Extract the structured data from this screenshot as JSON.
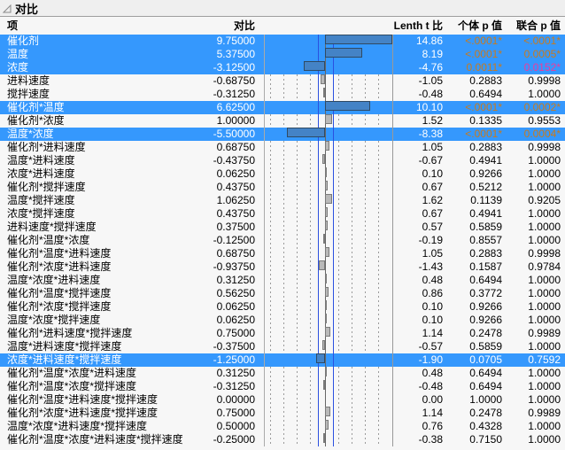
{
  "title": "对比",
  "disclosure_icon": "triangle-expanded-icon",
  "columns": {
    "term": "项",
    "contrast": "对比",
    "lenth_t": "Lenth t 比",
    "p_individual": "个体 p 值",
    "p_simultaneous": "联合 p 值"
  },
  "colors": {
    "row_highlight": "#3598fd",
    "significant_orange": "#c87a1e",
    "significant_pink": "#ef3a9b",
    "bar_highlight_fill": "#4483c6",
    "bar_normal_fill": "#b9b9b9",
    "reference_line_blue": "#2b50e0"
  },
  "rows": [
    {
      "term": "催化剂",
      "contrast": "9.75000",
      "t": "14.86",
      "p1": "<.0001*",
      "p2": "<.0001*",
      "hl": true,
      "p1c": "orange",
      "p2c": "orange",
      "v": 9.75
    },
    {
      "term": "温度",
      "contrast": "5.37500",
      "t": "8.19",
      "p1": "<.0001*",
      "p2": "0.0005*",
      "hl": true,
      "p1c": "orange",
      "p2c": "orange",
      "v": 5.375
    },
    {
      "term": "浓度",
      "contrast": "-3.12500",
      "t": "-4.76",
      "p1": "0.0011*",
      "p2": "0.0152*",
      "hl": true,
      "p1c": "orange",
      "p2c": "pink",
      "v": -3.125
    },
    {
      "term": "进料速度",
      "contrast": "-0.68750",
      "t": "-1.05",
      "p1": "0.2883",
      "p2": "0.9998",
      "hl": false,
      "p1c": null,
      "p2c": null,
      "v": -0.6875
    },
    {
      "term": "搅拌速度",
      "contrast": "-0.31250",
      "t": "-0.48",
      "p1": "0.6494",
      "p2": "1.0000",
      "hl": false,
      "p1c": null,
      "p2c": null,
      "v": -0.3125
    },
    {
      "term": "催化剂*温度",
      "contrast": "6.62500",
      "t": "10.10",
      "p1": "<.0001*",
      "p2": "0.0002*",
      "hl": true,
      "p1c": "orange",
      "p2c": "orange",
      "v": 6.625
    },
    {
      "term": "催化剂*浓度",
      "contrast": "1.00000",
      "t": "1.52",
      "p1": "0.1335",
      "p2": "0.9553",
      "hl": false,
      "p1c": null,
      "p2c": null,
      "v": 1.0
    },
    {
      "term": "温度*浓度",
      "contrast": "-5.50000",
      "t": "-8.38",
      "p1": "<.0001*",
      "p2": "0.0004*",
      "hl": true,
      "p1c": "orange",
      "p2c": "orange",
      "v": -5.5
    },
    {
      "term": "催化剂*进料速度",
      "contrast": "0.68750",
      "t": "1.05",
      "p1": "0.2883",
      "p2": "0.9998",
      "hl": false,
      "p1c": null,
      "p2c": null,
      "v": 0.6875
    },
    {
      "term": "温度*进料速度",
      "contrast": "-0.43750",
      "t": "-0.67",
      "p1": "0.4941",
      "p2": "1.0000",
      "hl": false,
      "p1c": null,
      "p2c": null,
      "v": -0.4375
    },
    {
      "term": "浓度*进料速度",
      "contrast": "0.06250",
      "t": "0.10",
      "p1": "0.9266",
      "p2": "1.0000",
      "hl": false,
      "p1c": null,
      "p2c": null,
      "v": 0.0625
    },
    {
      "term": "催化剂*搅拌速度",
      "contrast": "0.43750",
      "t": "0.67",
      "p1": "0.5212",
      "p2": "1.0000",
      "hl": false,
      "p1c": null,
      "p2c": null,
      "v": 0.4375
    },
    {
      "term": "温度*搅拌速度",
      "contrast": "1.06250",
      "t": "1.62",
      "p1": "0.1139",
      "p2": "0.9205",
      "hl": false,
      "p1c": null,
      "p2c": null,
      "v": 1.0625
    },
    {
      "term": "浓度*搅拌速度",
      "contrast": "0.43750",
      "t": "0.67",
      "p1": "0.4941",
      "p2": "1.0000",
      "hl": false,
      "p1c": null,
      "p2c": null,
      "v": 0.4375
    },
    {
      "term": "进料速度*搅拌速度",
      "contrast": "0.37500",
      "t": "0.57",
      "p1": "0.5859",
      "p2": "1.0000",
      "hl": false,
      "p1c": null,
      "p2c": null,
      "v": 0.375
    },
    {
      "term": "催化剂*温度*浓度",
      "contrast": "-0.12500",
      "t": "-0.19",
      "p1": "0.8557",
      "p2": "1.0000",
      "hl": false,
      "p1c": null,
      "p2c": null,
      "v": -0.125
    },
    {
      "term": "催化剂*温度*进料速度",
      "contrast": "0.68750",
      "t": "1.05",
      "p1": "0.2883",
      "p2": "0.9998",
      "hl": false,
      "p1c": null,
      "p2c": null,
      "v": 0.6875
    },
    {
      "term": "催化剂*浓度*进料速度",
      "contrast": "-0.93750",
      "t": "-1.43",
      "p1": "0.1587",
      "p2": "0.9784",
      "hl": false,
      "p1c": null,
      "p2c": null,
      "v": -0.9375
    },
    {
      "term": "温度*浓度*进料速度",
      "contrast": "0.31250",
      "t": "0.48",
      "p1": "0.6494",
      "p2": "1.0000",
      "hl": false,
      "p1c": null,
      "p2c": null,
      "v": 0.3125
    },
    {
      "term": "催化剂*温度*搅拌速度",
      "contrast": "0.56250",
      "t": "0.86",
      "p1": "0.3772",
      "p2": "1.0000",
      "hl": false,
      "p1c": null,
      "p2c": null,
      "v": 0.5625
    },
    {
      "term": "催化剂*浓度*搅拌速度",
      "contrast": "0.06250",
      "t": "0.10",
      "p1": "0.9266",
      "p2": "1.0000",
      "hl": false,
      "p1c": null,
      "p2c": null,
      "v": 0.0625
    },
    {
      "term": "温度*浓度*搅拌速度",
      "contrast": "0.06250",
      "t": "0.10",
      "p1": "0.9266",
      "p2": "1.0000",
      "hl": false,
      "p1c": null,
      "p2c": null,
      "v": 0.0625
    },
    {
      "term": "催化剂*进料速度*搅拌速度",
      "contrast": "0.75000",
      "t": "1.14",
      "p1": "0.2478",
      "p2": "0.9989",
      "hl": false,
      "p1c": null,
      "p2c": null,
      "v": 0.75
    },
    {
      "term": "温度*进料速度*搅拌速度",
      "contrast": "-0.37500",
      "t": "-0.57",
      "p1": "0.5859",
      "p2": "1.0000",
      "hl": false,
      "p1c": null,
      "p2c": null,
      "v": -0.375
    },
    {
      "term": "浓度*进料速度*搅拌速度",
      "contrast": "-1.25000",
      "t": "-1.90",
      "p1": "0.0705",
      "p2": "0.7592",
      "hl": true,
      "p1c": null,
      "p2c": null,
      "v": -1.25
    },
    {
      "term": "催化剂*温度*浓度*进料速度",
      "contrast": "0.31250",
      "t": "0.48",
      "p1": "0.6494",
      "p2": "1.0000",
      "hl": false,
      "p1c": null,
      "p2c": null,
      "v": 0.3125
    },
    {
      "term": "催化剂*温度*浓度*搅拌速度",
      "contrast": "-0.31250",
      "t": "-0.48",
      "p1": "0.6494",
      "p2": "1.0000",
      "hl": false,
      "p1c": null,
      "p2c": null,
      "v": -0.3125
    },
    {
      "term": "催化剂*温度*进料速度*搅拌速度",
      "contrast": "0.00000",
      "t": "0.00",
      "p1": "1.0000",
      "p2": "1.0000",
      "hl": false,
      "p1c": null,
      "p2c": null,
      "v": 0.0
    },
    {
      "term": "催化剂*浓度*进料速度*搅拌速度",
      "contrast": "0.75000",
      "t": "1.14",
      "p1": "0.2478",
      "p2": "0.9989",
      "hl": false,
      "p1c": null,
      "p2c": null,
      "v": 0.75
    },
    {
      "term": "温度*浓度*进料速度*搅拌速度",
      "contrast": "0.50000",
      "t": "0.76",
      "p1": "0.4328",
      "p2": "1.0000",
      "hl": false,
      "p1c": null,
      "p2c": null,
      "v": 0.5
    },
    {
      "term": "催化剂*温度*浓度*进料速度*搅拌速度",
      "contrast": "-0.25000",
      "t": "-0.38",
      "p1": "0.7150",
      "p2": "1.0000",
      "hl": false,
      "p1c": null,
      "p2c": null,
      "v": -0.25
    }
  ]
}
